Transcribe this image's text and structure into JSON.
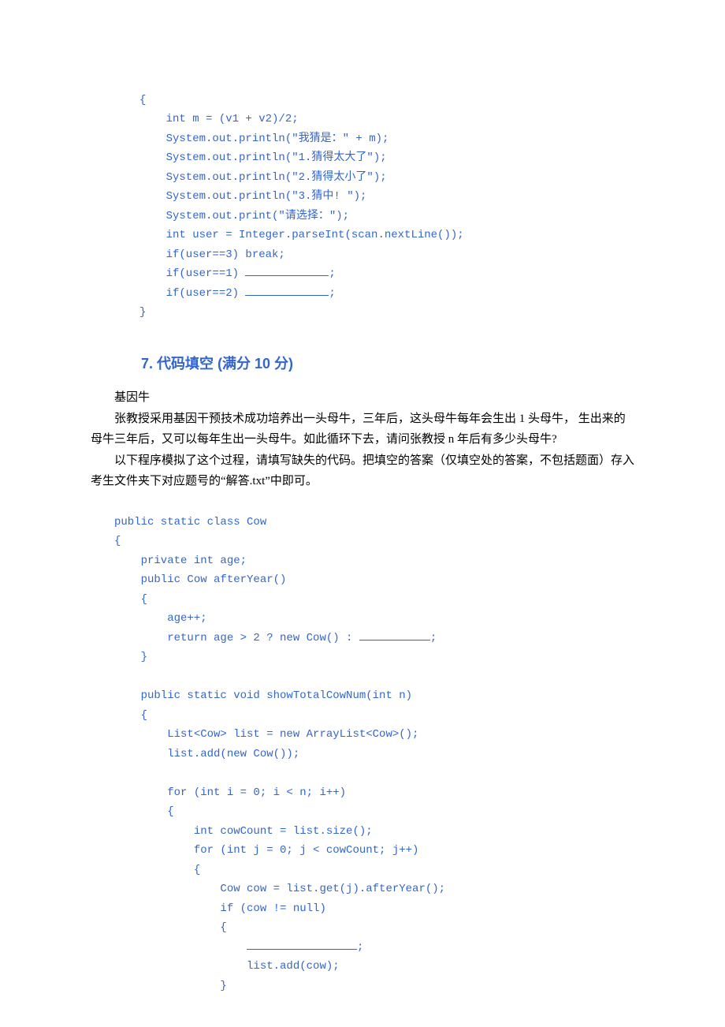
{
  "code1": {
    "l1": "{",
    "l2": "    int m = (v1 + v2)/2;",
    "l3": "    System.out.println(\"我猜是：\" + m);",
    "l4": "    System.out.println(\"1.猜得太大了\");",
    "l5": "    System.out.println(\"2.猜得太小了\");",
    "l6": "    System.out.println(\"3.猜中! \");",
    "l7": "    System.out.print(\"请选择：\");",
    "l8": "    int user = Integer.parseInt(scan.nextLine());",
    "l9": "    if(user==3) break;",
    "l10a": "    if(user==1) ",
    "l10b": ";",
    "l11a": "    if(user==2) ",
    "l11b": ";",
    "l12": "}"
  },
  "heading7": "7.  代码填空 (满分 10 分)",
  "prose": {
    "p1": "基因牛",
    "p2": "张教授采用基因干预技术成功培养出一头母牛，三年后，这头母牛每年会生出 1 头母牛， 生出来的母牛三年后，又可以每年生出一头母牛。如此循环下去，请问张教授 n 年后有多少头母牛?",
    "p3": "以下程序模拟了这个过程，请填写缺失的代码。把填空的答案（仅填空处的答案，不包括题面）存入考生文件夹下对应题号的“解答.txt”中即可。"
  },
  "code2": {
    "l1": "public static class Cow",
    "l2": "{",
    "l3": "    private int age;",
    "l4": "    public Cow afterYear()",
    "l5": "    {",
    "l6": "        age++;",
    "l7a": "        return age > 2 ? new Cow() : ",
    "l7b": ";",
    "l8": "    }",
    "l9": "",
    "l10": "    public static void showTotalCowNum(int n)",
    "l11": "    {",
    "l12": "        List<Cow> list = new ArrayList<Cow>();",
    "l13": "        list.add(new Cow());",
    "l14": "",
    "l15": "        for (int i = 0; i < n; i++)",
    "l16": "        {",
    "l17": "            int cowCount = list.size();",
    "l18": "            for (int j = 0; j < cowCount; j++)",
    "l19": "            {",
    "l20": "                Cow cow = list.get(j).afterYear();",
    "l21": "                if (cow != null)",
    "l22": "                {",
    "l23a": "                    ",
    "l23b": ";",
    "l24": "                    list.add(cow);",
    "l25": "                }"
  }
}
